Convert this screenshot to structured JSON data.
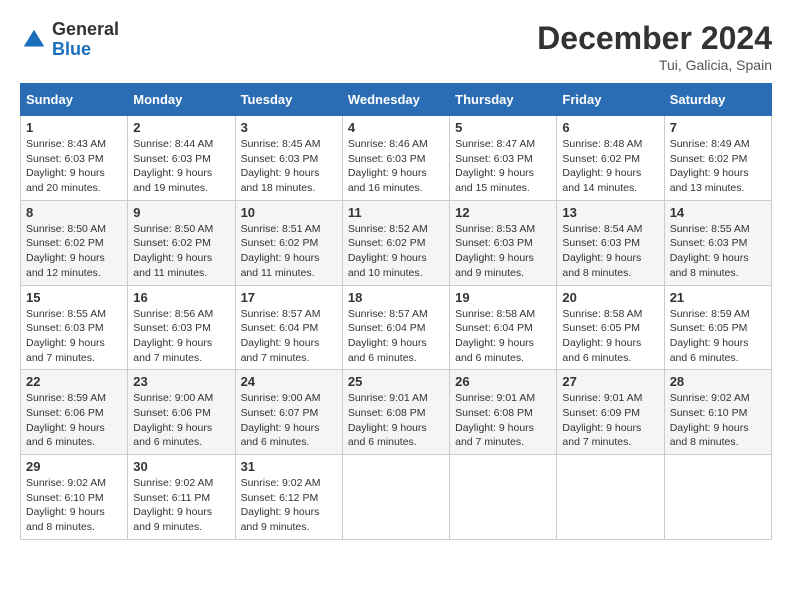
{
  "header": {
    "logo_general": "General",
    "logo_blue": "Blue",
    "month_title": "December 2024",
    "location": "Tui, Galicia, Spain"
  },
  "weekdays": [
    "Sunday",
    "Monday",
    "Tuesday",
    "Wednesday",
    "Thursday",
    "Friday",
    "Saturday"
  ],
  "weeks": [
    [
      {
        "day": 1,
        "sunrise": "8:43 AM",
        "sunset": "6:03 PM",
        "daylight": "9 hours and 20 minutes."
      },
      {
        "day": 2,
        "sunrise": "8:44 AM",
        "sunset": "6:03 PM",
        "daylight": "9 hours and 19 minutes."
      },
      {
        "day": 3,
        "sunrise": "8:45 AM",
        "sunset": "6:03 PM",
        "daylight": "9 hours and 18 minutes."
      },
      {
        "day": 4,
        "sunrise": "8:46 AM",
        "sunset": "6:03 PM",
        "daylight": "9 hours and 16 minutes."
      },
      {
        "day": 5,
        "sunrise": "8:47 AM",
        "sunset": "6:03 PM",
        "daylight": "9 hours and 15 minutes."
      },
      {
        "day": 6,
        "sunrise": "8:48 AM",
        "sunset": "6:02 PM",
        "daylight": "9 hours and 14 minutes."
      },
      {
        "day": 7,
        "sunrise": "8:49 AM",
        "sunset": "6:02 PM",
        "daylight": "9 hours and 13 minutes."
      }
    ],
    [
      {
        "day": 8,
        "sunrise": "8:50 AM",
        "sunset": "6:02 PM",
        "daylight": "9 hours and 12 minutes."
      },
      {
        "day": 9,
        "sunrise": "8:50 AM",
        "sunset": "6:02 PM",
        "daylight": "9 hours and 11 minutes."
      },
      {
        "day": 10,
        "sunrise": "8:51 AM",
        "sunset": "6:02 PM",
        "daylight": "9 hours and 11 minutes."
      },
      {
        "day": 11,
        "sunrise": "8:52 AM",
        "sunset": "6:02 PM",
        "daylight": "9 hours and 10 minutes."
      },
      {
        "day": 12,
        "sunrise": "8:53 AM",
        "sunset": "6:03 PM",
        "daylight": "9 hours and 9 minutes."
      },
      {
        "day": 13,
        "sunrise": "8:54 AM",
        "sunset": "6:03 PM",
        "daylight": "9 hours and 8 minutes."
      },
      {
        "day": 14,
        "sunrise": "8:55 AM",
        "sunset": "6:03 PM",
        "daylight": "9 hours and 8 minutes."
      }
    ],
    [
      {
        "day": 15,
        "sunrise": "8:55 AM",
        "sunset": "6:03 PM",
        "daylight": "9 hours and 7 minutes."
      },
      {
        "day": 16,
        "sunrise": "8:56 AM",
        "sunset": "6:03 PM",
        "daylight": "9 hours and 7 minutes."
      },
      {
        "day": 17,
        "sunrise": "8:57 AM",
        "sunset": "6:04 PM",
        "daylight": "9 hours and 7 minutes."
      },
      {
        "day": 18,
        "sunrise": "8:57 AM",
        "sunset": "6:04 PM",
        "daylight": "9 hours and 6 minutes."
      },
      {
        "day": 19,
        "sunrise": "8:58 AM",
        "sunset": "6:04 PM",
        "daylight": "9 hours and 6 minutes."
      },
      {
        "day": 20,
        "sunrise": "8:58 AM",
        "sunset": "6:05 PM",
        "daylight": "9 hours and 6 minutes."
      },
      {
        "day": 21,
        "sunrise": "8:59 AM",
        "sunset": "6:05 PM",
        "daylight": "9 hours and 6 minutes."
      }
    ],
    [
      {
        "day": 22,
        "sunrise": "8:59 AM",
        "sunset": "6:06 PM",
        "daylight": "9 hours and 6 minutes."
      },
      {
        "day": 23,
        "sunrise": "9:00 AM",
        "sunset": "6:06 PM",
        "daylight": "9 hours and 6 minutes."
      },
      {
        "day": 24,
        "sunrise": "9:00 AM",
        "sunset": "6:07 PM",
        "daylight": "9 hours and 6 minutes."
      },
      {
        "day": 25,
        "sunrise": "9:01 AM",
        "sunset": "6:08 PM",
        "daylight": "9 hours and 6 minutes."
      },
      {
        "day": 26,
        "sunrise": "9:01 AM",
        "sunset": "6:08 PM",
        "daylight": "9 hours and 7 minutes."
      },
      {
        "day": 27,
        "sunrise": "9:01 AM",
        "sunset": "6:09 PM",
        "daylight": "9 hours and 7 minutes."
      },
      {
        "day": 28,
        "sunrise": "9:02 AM",
        "sunset": "6:10 PM",
        "daylight": "9 hours and 8 minutes."
      }
    ],
    [
      {
        "day": 29,
        "sunrise": "9:02 AM",
        "sunset": "6:10 PM",
        "daylight": "9 hours and 8 minutes."
      },
      {
        "day": 30,
        "sunrise": "9:02 AM",
        "sunset": "6:11 PM",
        "daylight": "9 hours and 9 minutes."
      },
      {
        "day": 31,
        "sunrise": "9:02 AM",
        "sunset": "6:12 PM",
        "daylight": "9 hours and 9 minutes."
      },
      null,
      null,
      null,
      null
    ]
  ]
}
